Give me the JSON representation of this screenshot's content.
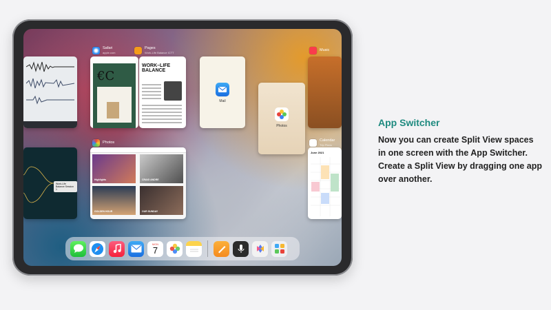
{
  "apps": {
    "safari": {
      "name": "Safari",
      "subtitle": "apple.com"
    },
    "pages": {
      "name": "Pages",
      "subtitle": "Work-Life Balance ICTT"
    },
    "music": {
      "name": "Music"
    },
    "photos": {
      "name": "Photos"
    },
    "calendar": {
      "name": "Calendar",
      "subtitle": "Trip Plans"
    }
  },
  "cards": {
    "safari_glyph": "€C",
    "pages_title": "WORK–LIFE BALANCE",
    "mail_label": "Mail",
    "photos_label": "Photos",
    "calendar_month": "June 2021",
    "mind_node": "Work-Life Balance Session 1",
    "photos_captions": [
      "Highlights",
      "CRAIG ANDRE",
      "GOLDEN HOUR",
      "OUR SUNDAY"
    ]
  },
  "dock": {
    "calendar_day_name": "MON",
    "calendar_day_num": "7",
    "icons": [
      "messages-icon",
      "safari-icon",
      "music-icon",
      "mail-icon",
      "calendar-icon",
      "photos-icon",
      "notes-icon",
      "pages-icon",
      "voice-memos-icon",
      "shortcuts-icon",
      "app-library-icon"
    ]
  },
  "info": {
    "title": "App Switcher",
    "body": "Now you can create Split View spaces in one screen with the App Switcher. Create a Split View by dragging one app over another."
  },
  "colors": {
    "accent": "#1e8a7f",
    "body_text": "#222222"
  }
}
